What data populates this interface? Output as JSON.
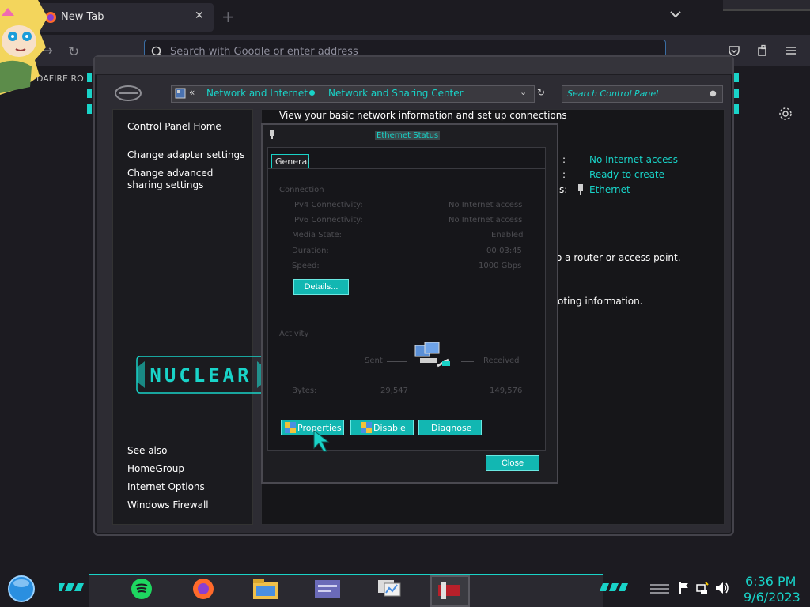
{
  "browser": {
    "tab_title": "New Tab",
    "url_placeholder": "Search with Google or enter address",
    "bookmark_text": "DAFIRE RO"
  },
  "control_panel": {
    "breadcrumb": [
      "Network and Internet",
      "Network and Sharing Center"
    ],
    "search_placeholder": "Search Control Panel",
    "header_text": "View your basic network information and set up connections",
    "sidebar": {
      "home": "Control Panel Home",
      "items": [
        "Change adapter settings",
        "Change advanced sharing settings"
      ],
      "see_also_title": "See also",
      "see_also": [
        "HomeGroup",
        "Internet Options",
        "Windows Firewall"
      ]
    },
    "logo_text": "NUCLEAR",
    "network_info": {
      "access": "No Internet access",
      "homegroup": "Ready to create",
      "connections": "Ethernet",
      "access_label_fragment": ":",
      "connections_label_fragment": "s:",
      "router_text": "o a router or access point.",
      "troubleshoot_text": "oting information."
    }
  },
  "ethernet_dialog": {
    "title": "Ethernet Status",
    "tab": "General",
    "connection_section": "Connection",
    "rows": [
      {
        "label": "IPv4 Connectivity:",
        "value": "No Internet access"
      },
      {
        "label": "IPv6 Connectivity:",
        "value": "No Internet access"
      },
      {
        "label": "Media State:",
        "value": "Enabled"
      },
      {
        "label": "Duration:",
        "value": "00:03:45"
      },
      {
        "label": "Speed:",
        "value": "1000 Gbps"
      }
    ],
    "details_button": "Details...",
    "activity_section": "Activity",
    "sent_label": "Sent",
    "received_label": "Received",
    "bytes_label": "Bytes:",
    "bytes_sent": "29,547",
    "bytes_received": "149,576",
    "buttons": {
      "properties": "Properties",
      "disable": "Disable",
      "diagnose": "Diagnose",
      "close": "Close"
    }
  },
  "taskbar": {
    "time": "6:36 PM",
    "date": "9/6/2023"
  },
  "colors": {
    "accent": "#19d3c8",
    "background": "#1c1b21"
  }
}
